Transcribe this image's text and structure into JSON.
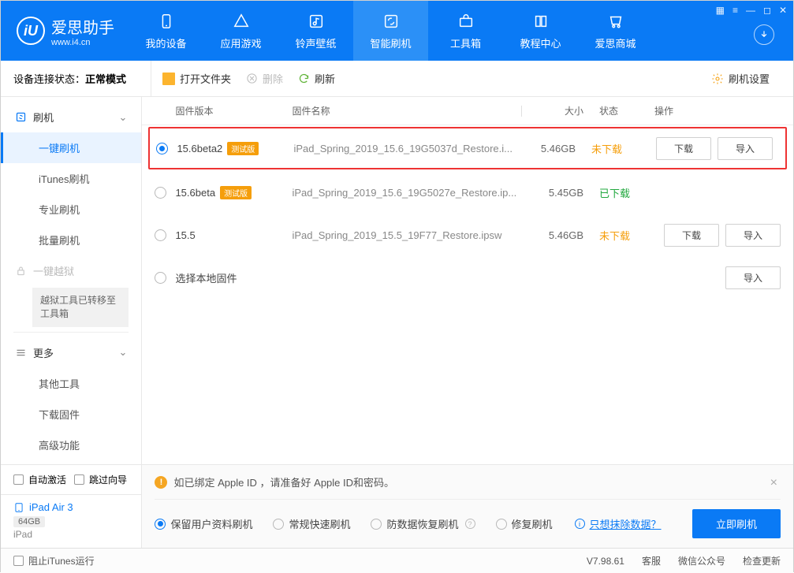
{
  "header": {
    "app_name": "爱思助手",
    "app_url": "www.i4.cn",
    "nav": [
      {
        "label": "我的设备"
      },
      {
        "label": "应用游戏"
      },
      {
        "label": "铃声壁纸"
      },
      {
        "label": "智能刷机"
      },
      {
        "label": "工具箱"
      },
      {
        "label": "教程中心"
      },
      {
        "label": "爱思商城"
      }
    ]
  },
  "toolbar": {
    "conn_label": "设备连接状态：",
    "conn_value": "正常模式",
    "open_folder": "打开文件夹",
    "delete": "删除",
    "refresh": "刷新",
    "settings": "刷机设置"
  },
  "sidebar": {
    "flash_group": "刷机",
    "items": {
      "one_click": "一键刷机",
      "itunes": "iTunes刷机",
      "pro": "专业刷机",
      "batch": "批量刷机"
    },
    "jailbreak_group": "一键越狱",
    "jailbreak_note": "越狱工具已转移至工具箱",
    "more_group": "更多",
    "more": {
      "other_tools": "其他工具",
      "download_fw": "下载固件",
      "advanced": "高级功能"
    },
    "auto_activate": "自动激活",
    "skip_guide": "跳过向导",
    "device_name": "iPad Air 3",
    "device_storage": "64GB",
    "device_type": "iPad"
  },
  "table": {
    "head": {
      "version": "固件版本",
      "name": "固件名称",
      "size": "大小",
      "status": "状态",
      "actions": "操作"
    },
    "rows": [
      {
        "version": "15.6beta2",
        "badge": "测试版",
        "name": "iPad_Spring_2019_15.6_19G5037d_Restore.i...",
        "size": "5.46GB",
        "status": "未下载",
        "status_class": "status-orange",
        "selected": true,
        "highlighted": true,
        "download": "下载",
        "import": "导入"
      },
      {
        "version": "15.6beta",
        "badge": "测试版",
        "name": "iPad_Spring_2019_15.6_19G5027e_Restore.ip...",
        "size": "5.45GB",
        "status": "已下载",
        "status_class": "status-green",
        "selected": false
      },
      {
        "version": "15.5",
        "badge": "",
        "name": "iPad_Spring_2019_15.5_19F77_Restore.ipsw",
        "size": "5.46GB",
        "status": "未下载",
        "status_class": "status-orange",
        "selected": false,
        "download": "下载",
        "import": "导入"
      },
      {
        "version": "选择本地固件",
        "badge": "",
        "name": "",
        "size": "",
        "status": "",
        "status_class": "",
        "selected": false,
        "import": "导入"
      }
    ]
  },
  "bottom": {
    "warn": "如已绑定 Apple ID ，请准备好 Apple ID和密码。",
    "opts": {
      "keep_data": "保留用户资料刷机",
      "fast": "常规快速刷机",
      "anti_data": "防数据恢复刷机",
      "repair": "修复刷机"
    },
    "erase_link": "只想抹除数据？",
    "primary": "立即刷机"
  },
  "footer": {
    "block_itunes": "阻止iTunes运行",
    "version": "V7.98.61",
    "support": "客服",
    "wechat": "微信公众号",
    "check_update": "检查更新"
  }
}
